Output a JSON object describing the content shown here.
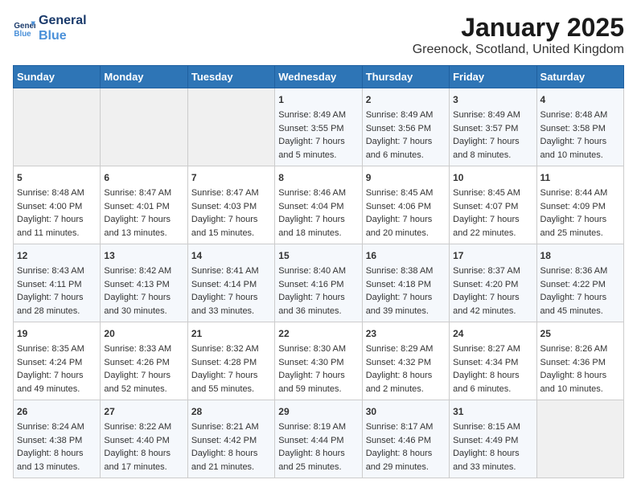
{
  "logo": {
    "line1": "General",
    "line2": "Blue"
  },
  "header": {
    "title": "January 2025",
    "subtitle": "Greenock, Scotland, United Kingdom"
  },
  "days_of_week": [
    "Sunday",
    "Monday",
    "Tuesday",
    "Wednesday",
    "Thursday",
    "Friday",
    "Saturday"
  ],
  "weeks": [
    [
      {
        "day": "",
        "content": ""
      },
      {
        "day": "",
        "content": ""
      },
      {
        "day": "",
        "content": ""
      },
      {
        "day": "1",
        "content": "Sunrise: 8:49 AM\nSunset: 3:55 PM\nDaylight: 7 hours\nand 5 minutes."
      },
      {
        "day": "2",
        "content": "Sunrise: 8:49 AM\nSunset: 3:56 PM\nDaylight: 7 hours\nand 6 minutes."
      },
      {
        "day": "3",
        "content": "Sunrise: 8:49 AM\nSunset: 3:57 PM\nDaylight: 7 hours\nand 8 minutes."
      },
      {
        "day": "4",
        "content": "Sunrise: 8:48 AM\nSunset: 3:58 PM\nDaylight: 7 hours\nand 10 minutes."
      }
    ],
    [
      {
        "day": "5",
        "content": "Sunrise: 8:48 AM\nSunset: 4:00 PM\nDaylight: 7 hours\nand 11 minutes."
      },
      {
        "day": "6",
        "content": "Sunrise: 8:47 AM\nSunset: 4:01 PM\nDaylight: 7 hours\nand 13 minutes."
      },
      {
        "day": "7",
        "content": "Sunrise: 8:47 AM\nSunset: 4:03 PM\nDaylight: 7 hours\nand 15 minutes."
      },
      {
        "day": "8",
        "content": "Sunrise: 8:46 AM\nSunset: 4:04 PM\nDaylight: 7 hours\nand 18 minutes."
      },
      {
        "day": "9",
        "content": "Sunrise: 8:45 AM\nSunset: 4:06 PM\nDaylight: 7 hours\nand 20 minutes."
      },
      {
        "day": "10",
        "content": "Sunrise: 8:45 AM\nSunset: 4:07 PM\nDaylight: 7 hours\nand 22 minutes."
      },
      {
        "day": "11",
        "content": "Sunrise: 8:44 AM\nSunset: 4:09 PM\nDaylight: 7 hours\nand 25 minutes."
      }
    ],
    [
      {
        "day": "12",
        "content": "Sunrise: 8:43 AM\nSunset: 4:11 PM\nDaylight: 7 hours\nand 28 minutes."
      },
      {
        "day": "13",
        "content": "Sunrise: 8:42 AM\nSunset: 4:13 PM\nDaylight: 7 hours\nand 30 minutes."
      },
      {
        "day": "14",
        "content": "Sunrise: 8:41 AM\nSunset: 4:14 PM\nDaylight: 7 hours\nand 33 minutes."
      },
      {
        "day": "15",
        "content": "Sunrise: 8:40 AM\nSunset: 4:16 PM\nDaylight: 7 hours\nand 36 minutes."
      },
      {
        "day": "16",
        "content": "Sunrise: 8:38 AM\nSunset: 4:18 PM\nDaylight: 7 hours\nand 39 minutes."
      },
      {
        "day": "17",
        "content": "Sunrise: 8:37 AM\nSunset: 4:20 PM\nDaylight: 7 hours\nand 42 minutes."
      },
      {
        "day": "18",
        "content": "Sunrise: 8:36 AM\nSunset: 4:22 PM\nDaylight: 7 hours\nand 45 minutes."
      }
    ],
    [
      {
        "day": "19",
        "content": "Sunrise: 8:35 AM\nSunset: 4:24 PM\nDaylight: 7 hours\nand 49 minutes."
      },
      {
        "day": "20",
        "content": "Sunrise: 8:33 AM\nSunset: 4:26 PM\nDaylight: 7 hours\nand 52 minutes."
      },
      {
        "day": "21",
        "content": "Sunrise: 8:32 AM\nSunset: 4:28 PM\nDaylight: 7 hours\nand 55 minutes."
      },
      {
        "day": "22",
        "content": "Sunrise: 8:30 AM\nSunset: 4:30 PM\nDaylight: 7 hours\nand 59 minutes."
      },
      {
        "day": "23",
        "content": "Sunrise: 8:29 AM\nSunset: 4:32 PM\nDaylight: 8 hours\nand 2 minutes."
      },
      {
        "day": "24",
        "content": "Sunrise: 8:27 AM\nSunset: 4:34 PM\nDaylight: 8 hours\nand 6 minutes."
      },
      {
        "day": "25",
        "content": "Sunrise: 8:26 AM\nSunset: 4:36 PM\nDaylight: 8 hours\nand 10 minutes."
      }
    ],
    [
      {
        "day": "26",
        "content": "Sunrise: 8:24 AM\nSunset: 4:38 PM\nDaylight: 8 hours\nand 13 minutes."
      },
      {
        "day": "27",
        "content": "Sunrise: 8:22 AM\nSunset: 4:40 PM\nDaylight: 8 hours\nand 17 minutes."
      },
      {
        "day": "28",
        "content": "Sunrise: 8:21 AM\nSunset: 4:42 PM\nDaylight: 8 hours\nand 21 minutes."
      },
      {
        "day": "29",
        "content": "Sunrise: 8:19 AM\nSunset: 4:44 PM\nDaylight: 8 hours\nand 25 minutes."
      },
      {
        "day": "30",
        "content": "Sunrise: 8:17 AM\nSunset: 4:46 PM\nDaylight: 8 hours\nand 29 minutes."
      },
      {
        "day": "31",
        "content": "Sunrise: 8:15 AM\nSunset: 4:49 PM\nDaylight: 8 hours\nand 33 minutes."
      },
      {
        "day": "",
        "content": ""
      }
    ]
  ]
}
